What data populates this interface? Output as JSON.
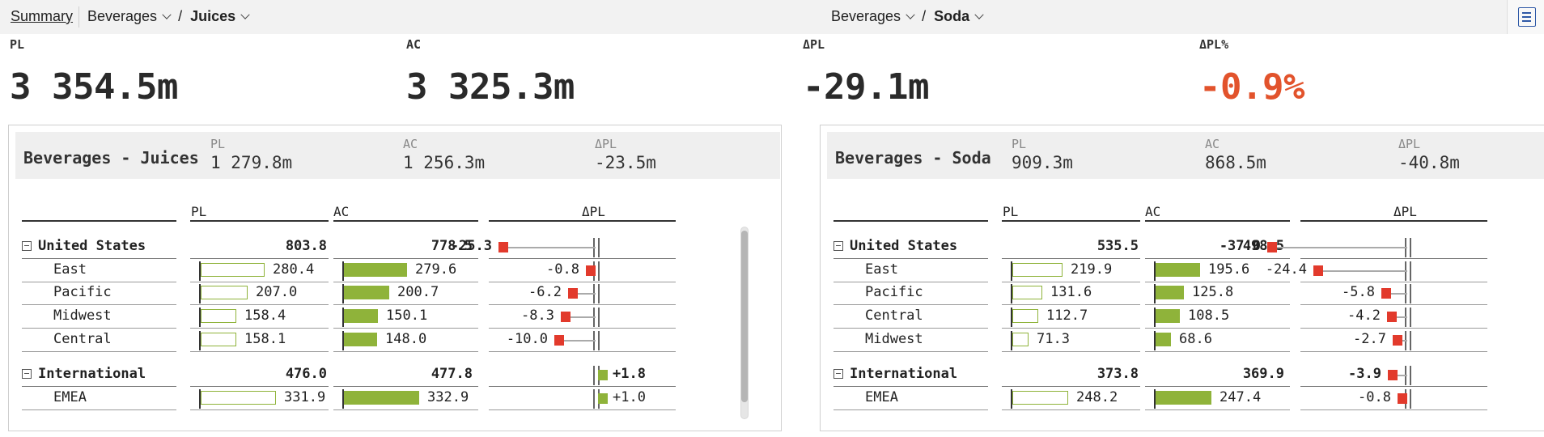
{
  "topbar": {
    "summary_label": "Summary",
    "left_crumb": {
      "level1": "Beverages",
      "separator": "/",
      "level2": "Juices"
    },
    "right_crumb": {
      "level1": "Beverages",
      "separator": "/",
      "level2": "Soda"
    },
    "menu_icon": "document-list-icon"
  },
  "kpis": [
    {
      "label": "PL",
      "value": "3 354.5m"
    },
    {
      "label": "AC",
      "value": "3 325.3m"
    },
    {
      "label": "ΔPL",
      "value": "-29.1m"
    },
    {
      "label": "ΔPL%",
      "value": "-0.9%",
      "color": "#e2532c"
    }
  ],
  "colors": {
    "positive": "#8fb33a",
    "negative": "#e23a2c",
    "accent_red": "#e2532c"
  },
  "panels": [
    {
      "title": "Beverages - Juices",
      "header_kpis": [
        {
          "label": "PL",
          "value": "1 279.8m"
        },
        {
          "label": "AC",
          "value": "1 256.3m"
        },
        {
          "label": "ΔPL",
          "value": "-23.5m"
        }
      ],
      "columns": {
        "pl": "PL",
        "ac": "AC",
        "dpl": "ΔPL"
      },
      "rows": [
        {
          "type": "group",
          "label": "United States",
          "pl": "803.8",
          "ac": "778.5",
          "dpl": "-25.3",
          "dval": -25.3
        },
        {
          "type": "child",
          "label": "East",
          "pl": "280.4",
          "ac": "279.6",
          "dpl": "-0.8",
          "plv": 280.4,
          "acv": 279.6,
          "dval": -0.8
        },
        {
          "type": "child",
          "label": "Pacific",
          "pl": "207.0",
          "ac": "200.7",
          "dpl": "-6.2",
          "plv": 207.0,
          "acv": 200.7,
          "dval": -6.2
        },
        {
          "type": "child",
          "label": "Midwest",
          "pl": "158.4",
          "ac": "150.1",
          "dpl": "-8.3",
          "plv": 158.4,
          "acv": 150.1,
          "dval": -8.3
        },
        {
          "type": "child",
          "label": "Central",
          "pl": "158.1",
          "ac": "148.0",
          "dpl": "-10.0",
          "plv": 158.1,
          "acv": 148.0,
          "dval": -10.0
        },
        {
          "type": "group",
          "label": "International",
          "pl": "476.0",
          "ac": "477.8",
          "dpl": "+1.8",
          "dval": 1.8
        },
        {
          "type": "child",
          "label": "EMEA",
          "pl": "331.9",
          "ac": "332.9",
          "dpl": "+1.0",
          "plv": 331.9,
          "acv": 332.9,
          "dval": 1.0
        }
      ]
    },
    {
      "title": "Beverages - Soda",
      "header_kpis": [
        {
          "label": "PL",
          "value": "909.3m"
        },
        {
          "label": "AC",
          "value": "868.5m"
        },
        {
          "label": "ΔPL",
          "value": "-40.8m"
        }
      ],
      "columns": {
        "pl": "PL",
        "ac": "AC",
        "dpl": "ΔPL"
      },
      "rows": [
        {
          "type": "group",
          "label": "United States",
          "pl": "535.5",
          "ac": "498.5",
          "dpl": "-37.0",
          "dval": -37.0
        },
        {
          "type": "child",
          "label": "East",
          "pl": "219.9",
          "ac": "195.6",
          "dpl": "-24.4",
          "plv": 219.9,
          "acv": 195.6,
          "dval": -24.4
        },
        {
          "type": "child",
          "label": "Pacific",
          "pl": "131.6",
          "ac": "125.8",
          "dpl": "-5.8",
          "plv": 131.6,
          "acv": 125.8,
          "dval": -5.8
        },
        {
          "type": "child",
          "label": "Central",
          "pl": "112.7",
          "ac": "108.5",
          "dpl": "-4.2",
          "plv": 112.7,
          "acv": 108.5,
          "dval": -4.2
        },
        {
          "type": "child",
          "label": "Midwest",
          "pl": "71.3",
          "ac": "68.6",
          "dpl": "-2.7",
          "plv": 71.3,
          "acv": 68.6,
          "dval": -2.7
        },
        {
          "type": "group",
          "label": "International",
          "pl": "373.8",
          "ac": "369.9",
          "dpl": "-3.9",
          "dval": -3.9
        },
        {
          "type": "child",
          "label": "EMEA",
          "pl": "248.2",
          "ac": "247.4",
          "dpl": "-0.8",
          "plv": 248.2,
          "acv": 247.4,
          "dval": -0.8
        }
      ]
    }
  ]
}
